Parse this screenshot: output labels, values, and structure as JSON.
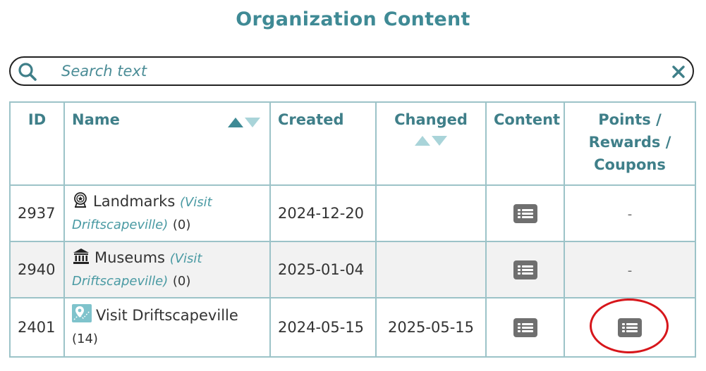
{
  "page": {
    "title": "Organization Content"
  },
  "search": {
    "placeholder": "Search text",
    "value": ""
  },
  "table": {
    "headers": {
      "id": "ID",
      "name": "Name",
      "created": "Created",
      "changed": "Changed",
      "content": "Content",
      "points": "Points / Rewards / Coupons"
    },
    "rows": [
      {
        "id": "2937",
        "icon": "landmark-icon",
        "name": "Landmarks",
        "parent": "(Visit Driftscapeville)",
        "count": "(0)",
        "created": "2024-12-20",
        "changed": "",
        "points": "-"
      },
      {
        "id": "2940",
        "icon": "museum-icon",
        "name": "Museums",
        "parent": "(Visit Driftscapeville)",
        "count": "(0)",
        "created": "2025-01-04",
        "changed": "",
        "points": "-"
      },
      {
        "id": "2401",
        "icon": "map-pin-icon",
        "name": "Visit Driftscapeville",
        "parent": "",
        "count": "(14)",
        "created": "2024-05-15",
        "changed": "2025-05-15",
        "points": "list-icon"
      }
    ]
  },
  "colors": {
    "accent": "#3f8a95",
    "border": "#9cc3c8",
    "highlight": "#d7161b",
    "button": "#6f6f6f"
  }
}
